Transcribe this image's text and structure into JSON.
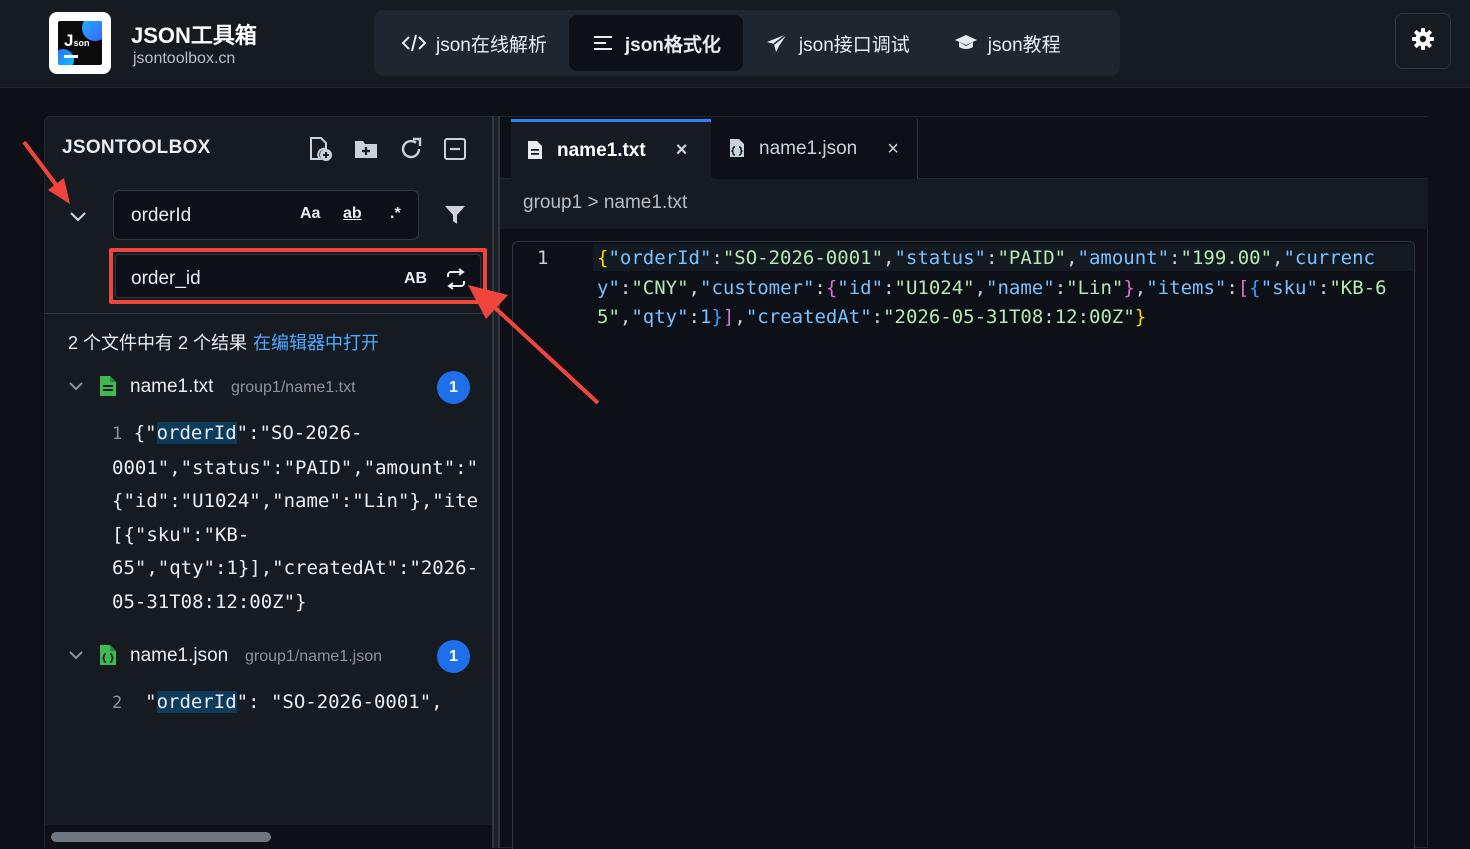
{
  "header": {
    "brand_title": "JSON工具箱",
    "brand_subtitle": "jsontoolbox.cn",
    "logo_text": "J",
    "logo_small": "son",
    "nav": [
      {
        "label": "json在线解析",
        "icon": "code-icon",
        "active": false
      },
      {
        "label": "json格式化",
        "icon": "align-left-icon",
        "active": true
      },
      {
        "label": "json接口调试",
        "icon": "paper-plane-icon",
        "active": false
      },
      {
        "label": "json教程",
        "icon": "graduation-cap-icon",
        "active": false
      }
    ],
    "settings_icon": "gear-icon"
  },
  "sidebar": {
    "title": "JSONTOOLBOX",
    "tools": [
      "new-file-icon",
      "new-folder-icon",
      "refresh-icon",
      "collapse-all-icon"
    ],
    "search": {
      "value": "orderId",
      "match_case": "Aa",
      "whole_word": "ab",
      "regex": ".*"
    },
    "replace": {
      "value": "order_id",
      "preserve_case": "AB"
    },
    "summary": "2 个文件中有 2 个结果",
    "open_in_editor": "在编辑器中打开",
    "results": [
      {
        "file": "name1.txt",
        "path": "group1/name1.txt",
        "count": "1",
        "line_no": "1",
        "lines": [
          {
            "pre": "{\"",
            "hl": "orderId",
            "post": "\":\"SO-2026-"
          },
          {
            "pre": "0001\",\"status\":\"PAID\",\"amount\":\"",
            "hl": "",
            "post": ""
          },
          {
            "pre": "{\"id\":\"U1024\",\"name\":\"Lin\"},\"ite",
            "hl": "",
            "post": ""
          },
          {
            "pre": "[{\"sku\":\"KB-",
            "hl": "",
            "post": ""
          },
          {
            "pre": "65\",\"qty\":1}],\"createdAt\":\"2026-",
            "hl": "",
            "post": ""
          },
          {
            "pre": "05-31T08:12:00Z\"}",
            "hl": "",
            "post": ""
          }
        ]
      },
      {
        "file": "name1.json",
        "path": "group1/name1.json",
        "count": "1",
        "line_no": "2",
        "lines": [
          {
            "pre": "\"",
            "hl": "orderId",
            "post": "\": \"SO-2026-0001\","
          }
        ]
      }
    ]
  },
  "editor": {
    "tabs": [
      {
        "label": "name1.txt",
        "active": true,
        "close": "×"
      },
      {
        "label": "name1.json",
        "active": false,
        "close": "×"
      }
    ],
    "breadcrumb": {
      "folder": "group1",
      "sep": ">",
      "file": "name1.txt"
    },
    "line_number": "1",
    "code": "{\"orderId\":\"SO-2026-0001\",\"status\":\"PAID\",\"amount\":\"199.00\",\"currency\":\"CNY\",\"customer\":{\"id\":\"U1024\",\"name\":\"Lin\"},\"items\":[{\"sku\":\"KB-65\",\"qty\":1}],\"createdAt\":\"2026-05-31T08:12:00Z\"}"
  },
  "colors": {
    "accent_blue": "#2f81f7",
    "highlight_red": "#f0453c",
    "badge_blue": "#1f6feb",
    "link_blue": "#4fa9ff"
  }
}
